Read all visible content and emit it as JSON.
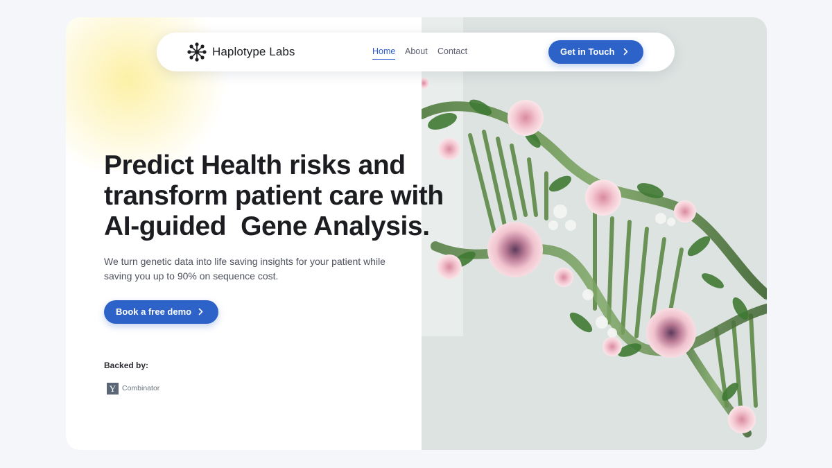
{
  "brand": {
    "name": "Haplotype Labs",
    "logo_icon": "molecule-asterisk-icon"
  },
  "nav": {
    "links": [
      {
        "label": "Home",
        "active": true
      },
      {
        "label": "About",
        "active": false
      },
      {
        "label": "Contact",
        "active": false
      }
    ],
    "cta_label": "Get in Touch",
    "cta_icon": "chevron-right-icon"
  },
  "hero": {
    "headline_lines": [
      "Predict Health risks and",
      "transform patient care with",
      "AI-guided  Gene Analysis."
    ],
    "subtitle_lines": [
      "We turn genetic data into life saving insights for your patient while",
      "saving you up to 90% on sequence cost."
    ],
    "demo_label": "Book a free demo",
    "demo_icon": "chevron-right-icon"
  },
  "backers": {
    "label": "Backed by:",
    "yc_letter": "Y",
    "yc_name": "Combinator"
  },
  "art": {
    "description_icon": "dna-helix-flowers-illustration"
  },
  "colors": {
    "accent": "#2d62c8",
    "nav_active": "#2a5bd0",
    "page_bg": "#f4f6f9",
    "art_bg": "#dde3e1",
    "headline": "#1c1d20"
  }
}
